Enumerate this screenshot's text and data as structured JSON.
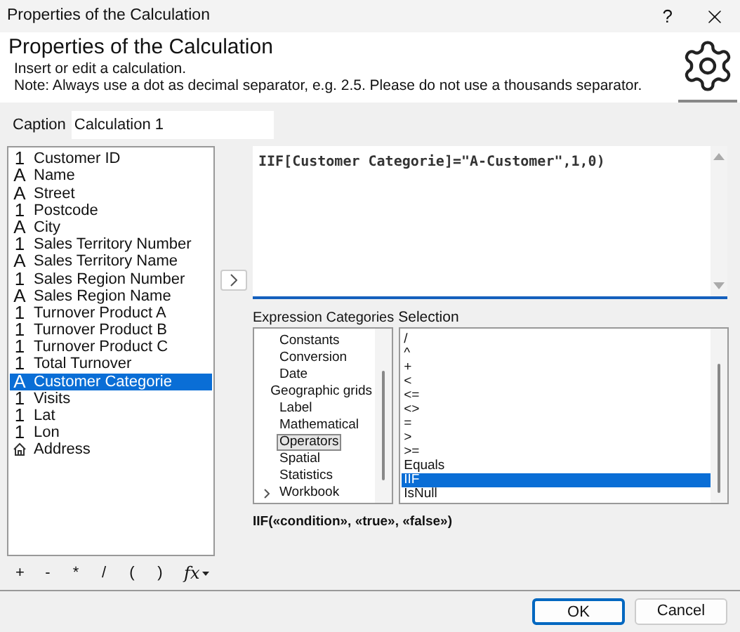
{
  "window": {
    "title": "Properties of the Calculation",
    "help": "?"
  },
  "header": {
    "title": "Properties of the Calculation",
    "lines": [
      "Insert or edit a calculation.",
      "Note: Always use a dot as decimal separator, e.g. 2.5. Please do not use a thousands separator."
    ]
  },
  "caption": {
    "label": "Caption",
    "value": "Calculation 1"
  },
  "fields": [
    {
      "kind": "number",
      "glyph": "1",
      "label": "Customer ID",
      "selected": false
    },
    {
      "kind": "text",
      "glyph": "A",
      "label": "Name",
      "selected": false
    },
    {
      "kind": "text",
      "glyph": "A",
      "label": "Street",
      "selected": false
    },
    {
      "kind": "number",
      "glyph": "1",
      "label": "Postcode",
      "selected": false
    },
    {
      "kind": "text",
      "glyph": "A",
      "label": "City",
      "selected": false
    },
    {
      "kind": "number",
      "glyph": "1",
      "label": "Sales Territory Number",
      "selected": false
    },
    {
      "kind": "text",
      "glyph": "A",
      "label": "Sales Territory Name",
      "selected": false
    },
    {
      "kind": "number",
      "glyph": "1",
      "label": "Sales Region Number",
      "selected": false
    },
    {
      "kind": "text",
      "glyph": "A",
      "label": "Sales Region Name",
      "selected": false
    },
    {
      "kind": "number",
      "glyph": "1",
      "label": "Turnover Product A",
      "selected": false
    },
    {
      "kind": "number",
      "glyph": "1",
      "label": "Turnover Product B",
      "selected": false
    },
    {
      "kind": "number",
      "glyph": "1",
      "label": "Turnover Product C",
      "selected": false
    },
    {
      "kind": "number",
      "glyph": "1",
      "label": "Total Turnover",
      "selected": false
    },
    {
      "kind": "text",
      "glyph": "A",
      "label": "Customer Categorie",
      "selected": true
    },
    {
      "kind": "number",
      "glyph": "1",
      "label": "Visits",
      "selected": false
    },
    {
      "kind": "number",
      "glyph": "1",
      "label": "Lat",
      "selected": false
    },
    {
      "kind": "number",
      "glyph": "1",
      "label": "Lon",
      "selected": false
    },
    {
      "kind": "address",
      "label": "Address",
      "selected": false
    }
  ],
  "expression": "IIF[Customer Categorie]=\"A-Customer\",1,0)",
  "categories": {
    "heading": "Expression Categories",
    "items": [
      {
        "label": "Constants",
        "selected": false,
        "expandable": false
      },
      {
        "label": "Conversion",
        "selected": false,
        "expandable": false
      },
      {
        "label": "Date",
        "selected": false,
        "expandable": false
      },
      {
        "label": "Geographic grids",
        "selected": false,
        "expandable": false
      },
      {
        "label": "Label",
        "selected": false,
        "expandable": false
      },
      {
        "label": "Mathematical",
        "selected": false,
        "expandable": false
      },
      {
        "label": "Operators",
        "selected": true,
        "expandable": false
      },
      {
        "label": "Spatial",
        "selected": false,
        "expandable": false
      },
      {
        "label": "Statistics",
        "selected": false,
        "expandable": false
      },
      {
        "label": "Workbook",
        "selected": false,
        "expandable": true
      }
    ]
  },
  "selection": {
    "heading": "Selection",
    "items": [
      {
        "label": "/",
        "selected": false
      },
      {
        "label": "^",
        "selected": false
      },
      {
        "label": "+",
        "selected": false
      },
      {
        "label": "<",
        "selected": false
      },
      {
        "label": "<=",
        "selected": false
      },
      {
        "label": "<>",
        "selected": false
      },
      {
        "label": "=",
        "selected": false
      },
      {
        "label": ">",
        "selected": false
      },
      {
        "label": ">=",
        "selected": false
      },
      {
        "label": "Equals",
        "selected": false
      },
      {
        "label": "IIF",
        "selected": true
      },
      {
        "label": "IsNull",
        "selected": false
      }
    ]
  },
  "signature": "IIF(«condition», «true», «false»)",
  "operators": [
    "+",
    "-",
    "*",
    "/",
    "(",
    ")"
  ],
  "function_button": "fx",
  "buttons": [
    {
      "label": "OK",
      "default": true
    },
    {
      "label": "Cancel",
      "default": false
    }
  ]
}
